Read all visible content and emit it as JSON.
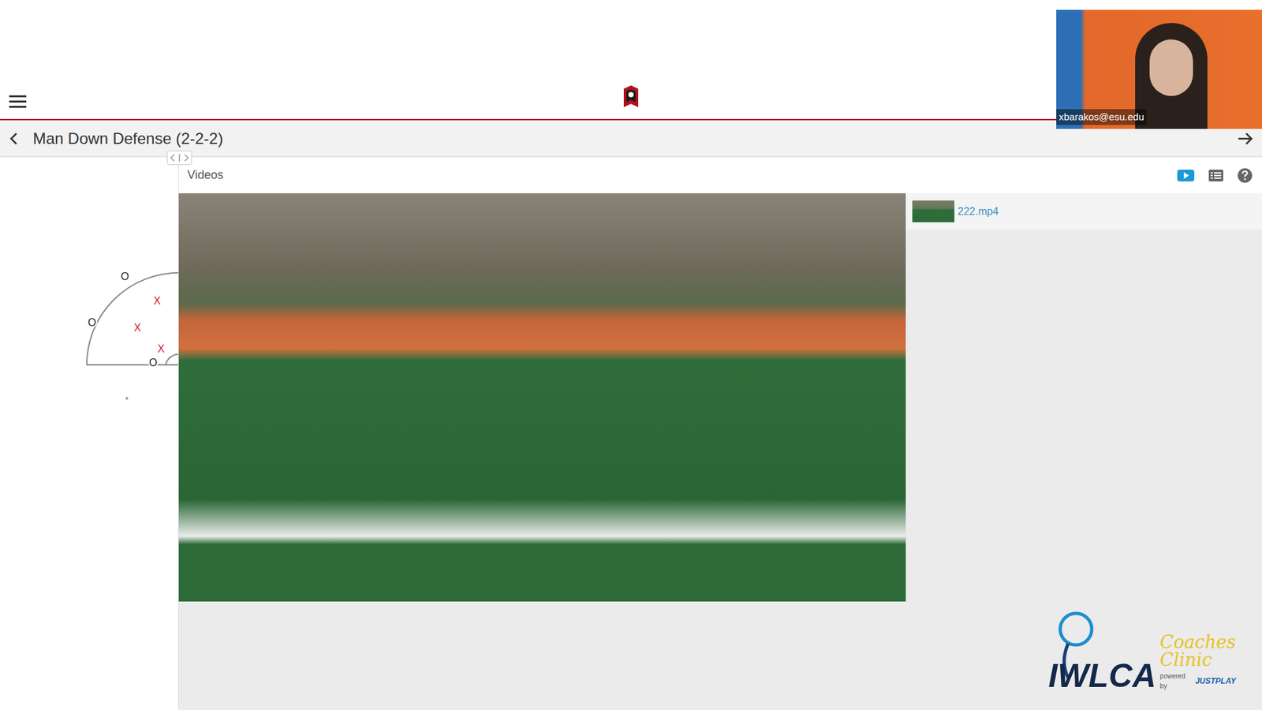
{
  "webcam": {
    "name": "xbarakos@esu.edu"
  },
  "page": {
    "title": "Man Down Defense (2-2-2)"
  },
  "diagram": {
    "players": [
      {
        "label": "O",
        "color": "#222222"
      },
      {
        "label": "O",
        "color": "#222222"
      },
      {
        "label": "O",
        "color": "#222222"
      },
      {
        "label": "X",
        "color": "#d0202a"
      },
      {
        "label": "X",
        "color": "#d0202a"
      },
      {
        "label": "X",
        "color": "#d0202a"
      }
    ]
  },
  "videos": {
    "label": "Videos",
    "toolbar": [
      {
        "kind": "video",
        "selected": true
      },
      {
        "kind": "list",
        "selected": false
      },
      {
        "kind": "help",
        "selected": false
      }
    ]
  },
  "files": [
    {
      "name": "222.mp4",
      "selected": false
    }
  ],
  "sponsor": {
    "title": "IWLCA",
    "subtitle": "Coaches Clinic",
    "powered": "powered by",
    "brand": "JUSTPLAY"
  }
}
